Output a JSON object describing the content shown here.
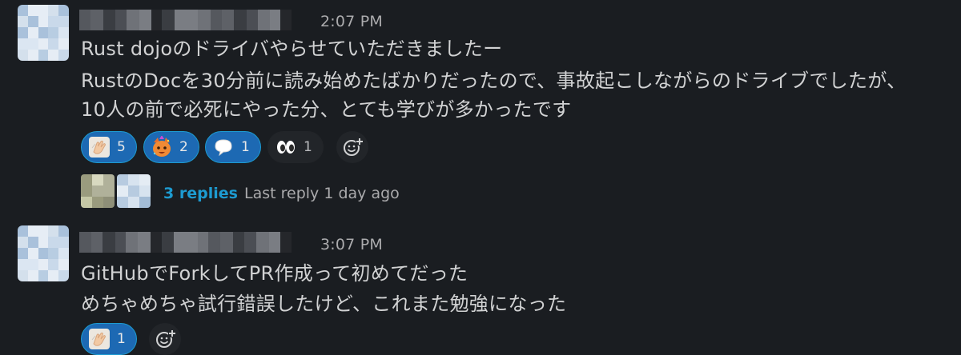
{
  "messages": [
    {
      "timestamp": "2:07 PM",
      "lines": [
        "Rust dojoのドライバやらせていただきましたー",
        "RustのDocを30分前に読み始めたばかりだったので、事故起こしながらのドライブでしたが、",
        "10人の前で必死にやった分、とても学びが多かったです"
      ],
      "reactions": [
        {
          "emoji": "clap-emoji",
          "count": "5",
          "active": true
        },
        {
          "emoji": "party-cat-emoji",
          "count": "2",
          "active": true
        },
        {
          "emoji": "speech-bubble-emoji",
          "count": "1",
          "active": true
        },
        {
          "emoji": "eyes-emoji",
          "count": "1",
          "active": false
        }
      ],
      "thread": {
        "replies_label": "3 replies",
        "last_reply": "Last reply 1 day ago"
      }
    },
    {
      "timestamp": "3:07 PM",
      "lines": [
        "GitHubでForkしてPR作成って初めてだった",
        "めちゃめちゃ試行錯誤したけど、これまた勉強になった"
      ],
      "reactions": [
        {
          "emoji": "clap-emoji",
          "count": "1",
          "active": true
        }
      ]
    }
  ],
  "colors": {
    "background": "#1a1d21",
    "text": "#d1d2d3",
    "muted": "#ababad",
    "link": "#1d9bd1",
    "reaction_active_bg": "#1d69b3",
    "reaction_active_border": "#1d9bd1"
  }
}
